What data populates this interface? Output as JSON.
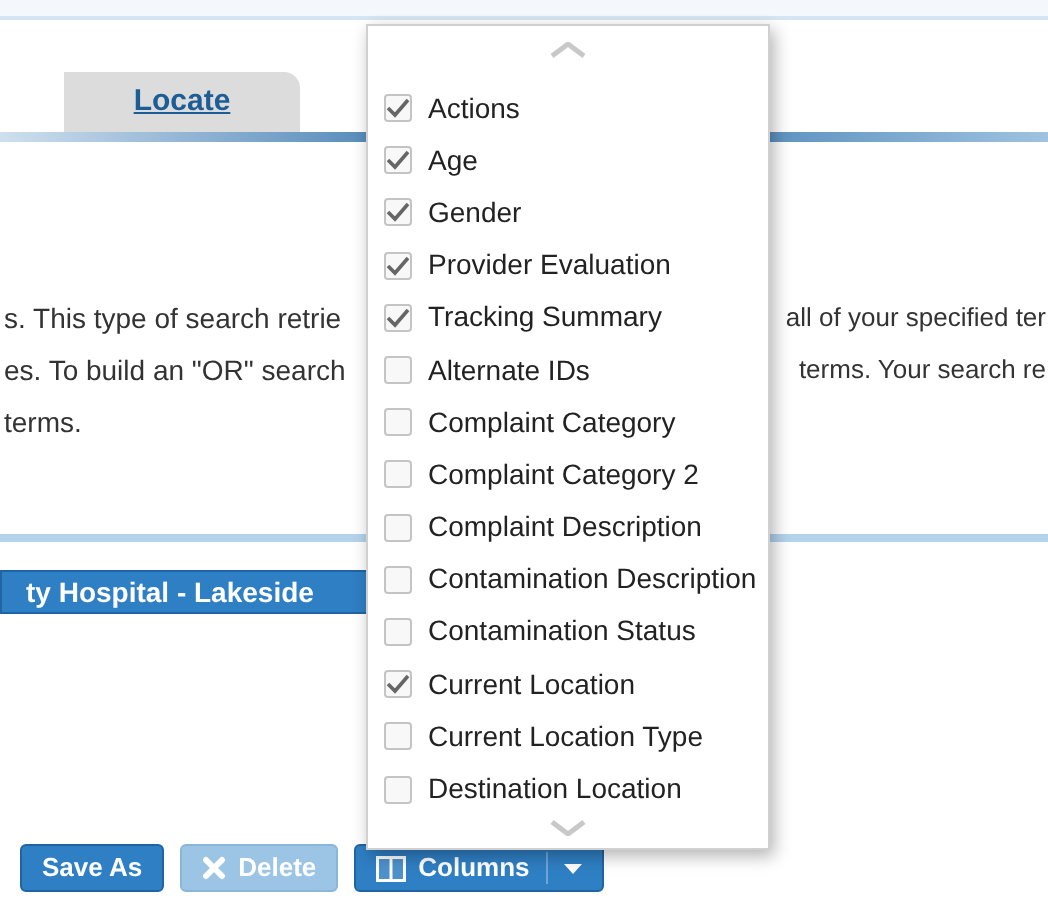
{
  "tabs": [
    {
      "label": "Locate",
      "selected": true
    }
  ],
  "description": [
    {
      "left": "s. This type of search retrie",
      "right": "all of your specified ter"
    },
    {
      "left": "es. To build an \"OR\" search",
      "right": "terms. Your search re"
    },
    {
      "left": "terms."
    }
  ],
  "facility_header": {
    "label": "ty Hospital - Lakeside"
  },
  "column_menu": {
    "items": [
      {
        "label": "Actions",
        "checked": true
      },
      {
        "label": "Age",
        "checked": true
      },
      {
        "label": "Gender",
        "checked": true
      },
      {
        "label": "Provider Evaluation",
        "checked": true
      },
      {
        "label": "Tracking Summary",
        "checked": true
      },
      {
        "label": "Alternate IDs",
        "checked": false
      },
      {
        "label": "Complaint Category",
        "checked": false
      },
      {
        "label": "Complaint Category 2",
        "checked": false
      },
      {
        "label": "Complaint Description",
        "checked": false
      },
      {
        "label": "Contamination Description",
        "checked": false
      },
      {
        "label": "Contamination Status",
        "checked": false
      },
      {
        "label": "Current Location",
        "checked": true
      },
      {
        "label": "Current Location Type",
        "checked": false
      },
      {
        "label": "Destination Location",
        "checked": false
      }
    ]
  },
  "buttons": [
    {
      "kind": "save_as",
      "label": "Save As",
      "disabled": false
    },
    {
      "kind": "delete",
      "label": "Delete",
      "disabled": true
    },
    {
      "kind": "columns",
      "label": "Columns",
      "disabled": false
    }
  ]
}
